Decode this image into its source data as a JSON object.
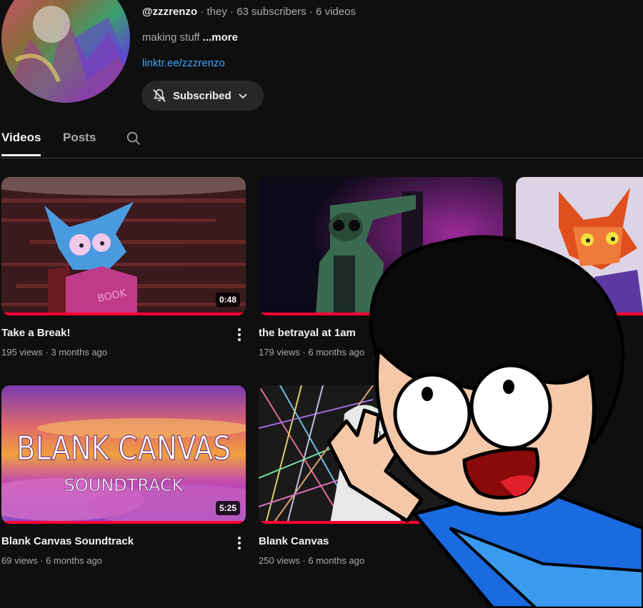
{
  "channel": {
    "handle": "@zzzrenzo",
    "pronouns": "they",
    "subscribers": "63 subscribers",
    "video_count": "6 videos",
    "separator": " · ",
    "description": "making stuff",
    "more_label": "...more",
    "link": "linktr.ee/zzzrenzo",
    "subscribe_label": "Subscribed"
  },
  "tabs": [
    {
      "label": "Videos",
      "active": true
    },
    {
      "label": "Posts",
      "active": false
    }
  ],
  "videos": [
    {
      "title": "Take a Break!",
      "meta": "195 views · 3 months ago",
      "duration": "0:48"
    },
    {
      "title": "the betrayal at 1am",
      "meta": "179 views · 6 months ago",
      "duration": ""
    },
    {
      "title": "",
      "meta": "",
      "duration": ""
    },
    {
      "title": "Blank Canvas Soundtrack",
      "meta": "69 views · 6 months ago",
      "duration": "5:25"
    },
    {
      "title": "Blank Canvas",
      "meta": "250 views · 6 months ago",
      "duration": ""
    }
  ],
  "thumb_art": {
    "blank_canvas_line1": "BLANK CANVAS",
    "blank_canvas_line2": "SOUNDTRACK",
    "book_text": "BOOK"
  },
  "colors": {
    "background": "#0f0f0f",
    "progress": "#ff0033",
    "link": "#3ea6ff",
    "button": "#272727"
  },
  "icons": [
    "bell-off-icon",
    "chevron-down-icon",
    "search-icon",
    "more-vert-icon"
  ]
}
